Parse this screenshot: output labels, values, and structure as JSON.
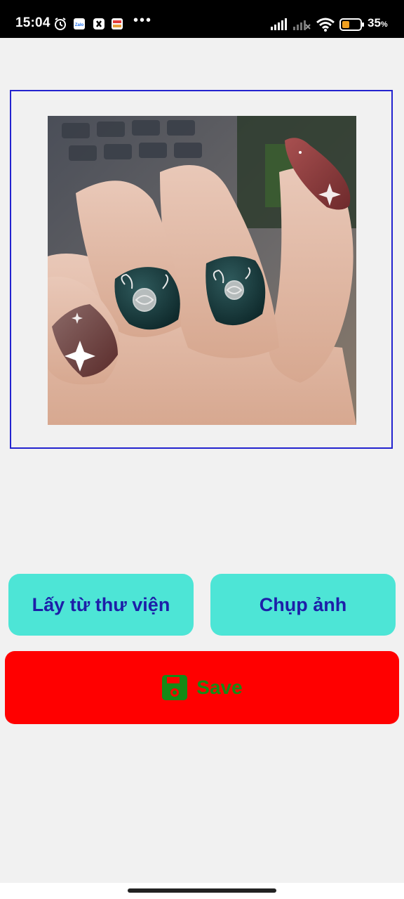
{
  "status_bar": {
    "time": "15:04",
    "notif_icons": [
      "alarm-icon",
      "zalo-icon",
      "app-icon",
      "app-icon-2"
    ],
    "more": "•••",
    "battery_percent": "35",
    "battery_unit": "%"
  },
  "image_preview": {
    "description_icon": "nail-photo"
  },
  "buttons": {
    "library_label": "Lấy từ thư viện",
    "camera_label": "Chụp ảnh",
    "save_label": "Save"
  },
  "colors": {
    "primary_button_bg": "#4de5d6",
    "primary_button_text": "#1d1ea8",
    "save_bg": "#ff0000",
    "save_text": "#168a16",
    "frame_border": "#2323cf"
  }
}
